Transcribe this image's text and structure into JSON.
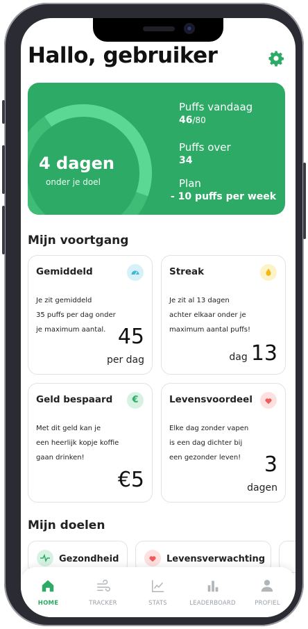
{
  "header": {
    "greeting": "Hallo, gebruiker",
    "settings_icon": "gear-icon"
  },
  "hero": {
    "days_value": "4 dagen",
    "days_sub": "onder je doel",
    "progress_fraction": 0.4,
    "puffs_label": "Puffs vandaag",
    "puffs_today": "46",
    "puffs_max": "/80",
    "remaining_label": "Puffs over",
    "remaining_value": "34",
    "plan_label": "Plan",
    "plan_value": "- 10 puffs per week"
  },
  "progress": {
    "title": "Mijn voortgang",
    "cards": [
      {
        "title": "Gemiddeld",
        "icon": "gauge-icon",
        "lines": [
          "Je zit gemiddeld",
          "35 puffs per dag onder",
          "je maximum aantal."
        ],
        "value": "45",
        "unit": "per dag"
      },
      {
        "title": "Streak",
        "icon": "drop-icon",
        "lines": [
          "Je zit al 13 dagen",
          "achter elkaar onder je",
          "maximum aantal puffs!"
        ],
        "value": "13",
        "unit": "dag"
      },
      {
        "title": "Geld bespaard",
        "icon": "euro-icon",
        "lines": [
          "Met dit geld kan je",
          "een heerlijk kopje koffie",
          "gaan drinken!"
        ],
        "value": "€5",
        "unit": ""
      },
      {
        "title": "Levensvoordeel",
        "icon": "heart-icon",
        "lines": [
          "Elke dag zonder vapen",
          "is een dag dichter bij",
          "een gezonder leven!"
        ],
        "value": "3",
        "unit": "dagen"
      }
    ]
  },
  "goals": {
    "title": "Mijn doelen",
    "items": [
      {
        "label": "Gezondheid",
        "icon": "pulse-icon"
      },
      {
        "label": "Levensverwachting",
        "icon": "heart-icon"
      }
    ]
  },
  "nav": {
    "items": [
      {
        "label": "HOME",
        "icon": "home-icon",
        "active": true
      },
      {
        "label": "TRACKER",
        "icon": "wind-icon"
      },
      {
        "label": "STATS",
        "icon": "line-chart-icon"
      },
      {
        "label": "LEADERBOARD",
        "icon": "bar-chart-icon"
      },
      {
        "label": "PROFIEL",
        "icon": "user-icon"
      }
    ]
  },
  "colors": {
    "accent": "#2eaa67",
    "accent_light": "#4fd08a"
  }
}
